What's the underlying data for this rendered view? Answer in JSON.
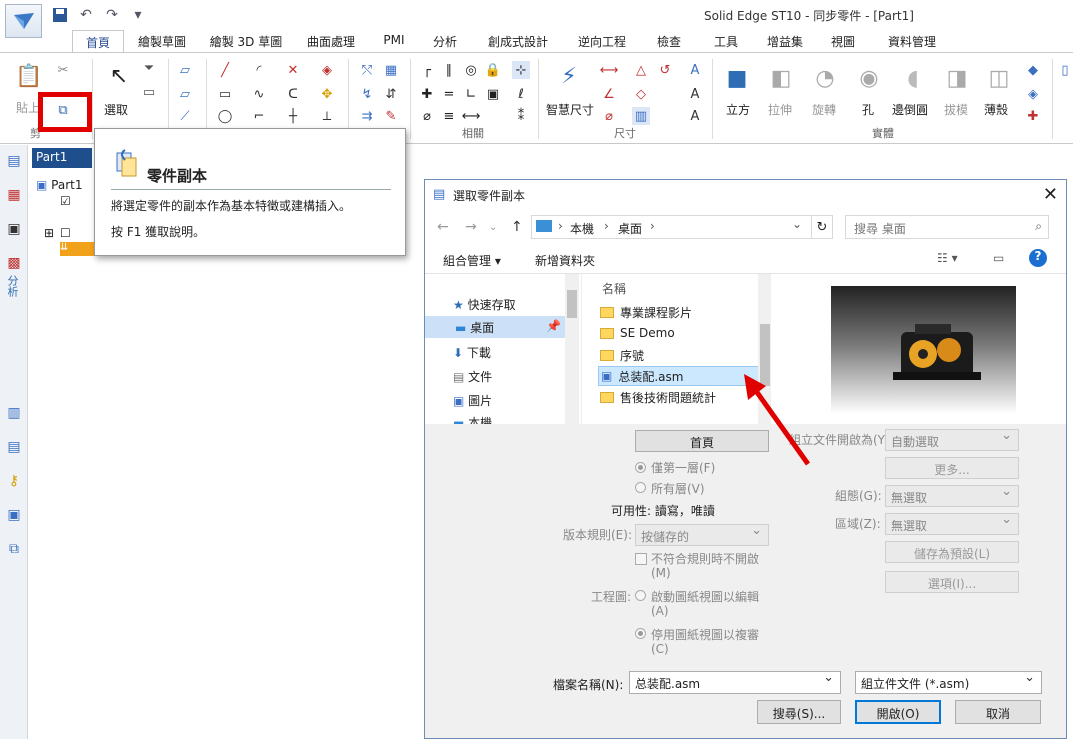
{
  "app": {
    "title": "Solid Edge ST10 - 同步零件 - [Part1]"
  },
  "tabs": [
    "首頁",
    "繪製草圖",
    "繪製 3D 草圖",
    "曲面處理",
    "PMI",
    "分析",
    "創成式設計",
    "逆向工程",
    "檢查",
    "工具",
    "增益集",
    "視圖",
    "資料管理"
  ],
  "ribbon": {
    "paste": "貼上",
    "select": "選取",
    "clipboard_group": "剪",
    "smart_dimension": "智慧尺寸",
    "relate_group": "相關",
    "dimension_group": "尺寸",
    "solids_group": "實體",
    "solids": [
      "立方",
      "拉伸",
      "旋轉",
      "孔",
      "邊倒圓",
      "拔模",
      "薄殼"
    ]
  },
  "pathfinder": {
    "tab": "Part1",
    "root": "Part1"
  },
  "left_strip": {
    "analysis": "分析"
  },
  "tooltip": {
    "title": "零件副本",
    "description": "將選定零件的副本作為基本特徵或建構插入。",
    "help": "按 F1 獲取說明。"
  },
  "dialog": {
    "title": "選取零件副本",
    "address": [
      "本機",
      "桌面"
    ],
    "search_placeholder": "搜尋 桌面",
    "organize": "組合管理",
    "new_folder": "新增資料夾",
    "nav": [
      {
        "label": "快速存取"
      },
      {
        "label": "桌面"
      },
      {
        "label": "下載"
      },
      {
        "label": "文件"
      },
      {
        "label": "圖片"
      },
      {
        "label": "本機"
      }
    ],
    "column_name": "名稱",
    "files": [
      {
        "label": "專業課程影片"
      },
      {
        "label": "SE Demo"
      },
      {
        "label": "序號"
      },
      {
        "label": "总装配.asm"
      },
      {
        "label": "售後技術問題統計"
      }
    ],
    "home_btn": "首頁",
    "radio_first_level": "僅第一層(F)",
    "radio_all_levels": "所有層(V)",
    "availability": "可用性: 讀寫，唯讀",
    "version_rule_label": "版本規則(E):",
    "version_rule_value": "按儲存的",
    "no_match_open": "不符合規則時不開啟",
    "no_match_open_key": "(M)",
    "drawing_label": "工程圖:",
    "drawing_enable": "啟動圖紙視圖以編輯",
    "drawing_enable_key": "(A)",
    "drawing_disable": "停用圖紙視圖以複審",
    "drawing_disable_key": "(C)",
    "open_as_label": "組立文件開啟為(Y):",
    "open_as_value": "自動選取",
    "more": "更多...",
    "config_label": "組態(G):",
    "config_value": "無選取",
    "zone_label": "區域(Z):",
    "zone_value": "無選取",
    "save_default": "儲存為預設(L)",
    "options": "選項(I)...",
    "filename_label": "檔案名稱(N):",
    "filename_value": "总装配.asm",
    "filetype_value": "組立件文件 (*.asm)",
    "search_btn": "搜尋(S)...",
    "open_btn": "開啟(O)",
    "cancel_btn": "取消"
  },
  "colors": {
    "highlight": "#e00000",
    "accent": "#1f4e8c",
    "selection": "#cce8ff"
  }
}
